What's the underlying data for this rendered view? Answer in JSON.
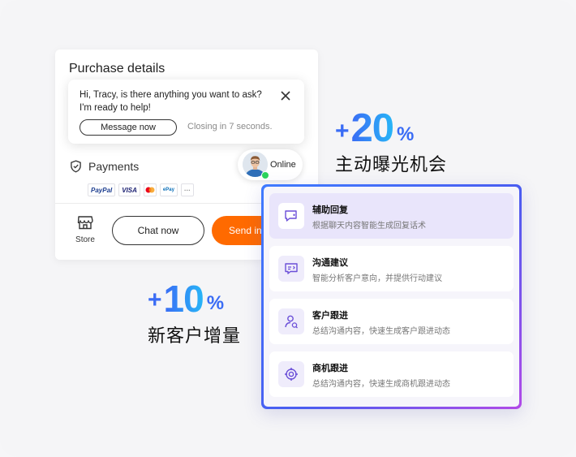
{
  "purchase": {
    "title": "Purchase details",
    "payments_label": "Payments",
    "pay_logos": [
      "PayPal",
      "VISA",
      "MC",
      "ePay",
      "···"
    ],
    "store_label": "Store",
    "chat_now_label": "Chat now",
    "send_label": "Send inq"
  },
  "bubble": {
    "line1": "Hi, Tracy, is there anything you want to ask?",
    "line2": "I'm ready to help!",
    "message_button": "Message now",
    "closing": "Closing in 7 seconds."
  },
  "agent": {
    "status": "Online"
  },
  "stats": {
    "top": {
      "plus": "+",
      "value": "20",
      "unit": "%",
      "label": "主动曝光机会"
    },
    "bottom": {
      "plus": "+",
      "value": "10",
      "unit": "%",
      "label": "新客户增量"
    }
  },
  "features": [
    {
      "title": "辅助回复",
      "desc": "根据聊天内容智能生成回复话术",
      "icon": "chat-reply-icon",
      "active": true
    },
    {
      "title": "沟通建议",
      "desc": "智能分析客户意向，并提供行动建议",
      "icon": "suggestion-icon",
      "active": false
    },
    {
      "title": "客户跟进",
      "desc": "总结沟通内容，快速生成客户跟进动态",
      "icon": "user-follow-icon",
      "active": false
    },
    {
      "title": "商机跟进",
      "desc": "总结沟通内容，快速生成商机跟进动态",
      "icon": "target-icon",
      "active": false
    }
  ],
  "colors": {
    "accent_orange": "#ff6a00",
    "stat_blue": "#3a6cf5",
    "feature_purple": "#6b4fd8",
    "online_green": "#2bd45b"
  }
}
